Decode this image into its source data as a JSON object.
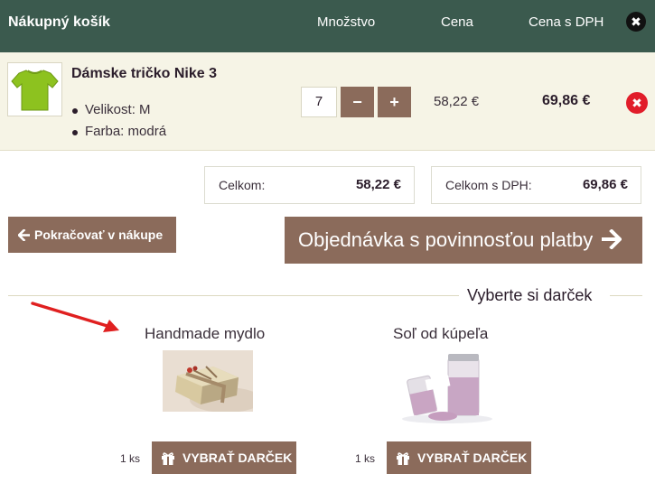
{
  "header": {
    "title": "Nákupný košík",
    "col_quantity": "Množstvo",
    "col_price": "Cena",
    "col_price_vat": "Cena s DPH",
    "close_icon": "✖"
  },
  "item": {
    "name": "Dámske tričko Nike 3",
    "attributes": [
      "Velikost: M",
      "Farba: modrá"
    ],
    "quantity": "7",
    "minus_label": "−",
    "plus_label": "+",
    "price": "58,22 €",
    "price_vat": "69,86 €",
    "remove_icon": "✖",
    "image_icon": "green-tshirt-image"
  },
  "totals": {
    "total_label": "Celkom:",
    "total_value": "58,22 €",
    "total_vat_label": "Celkom s DPH:",
    "total_vat_value": "69,86 €"
  },
  "actions": {
    "continue_label": "Pokračovať v nákupe",
    "continue_icon": "arrow-left-icon",
    "order_label": "Objednávka s povinnosťou platby",
    "order_icon": "arrow-right-icon"
  },
  "gifts": {
    "section_title": "Vyberte si darček",
    "items": [
      {
        "name": "Handmade mydlo",
        "qty": "1 ks",
        "button_label": "VYBRAŤ DARČEK",
        "icon": "gift-icon"
      },
      {
        "name": "Soľ od kúpeľa",
        "qty": "1 ks",
        "button_label": "VYBRAŤ DARČEK",
        "icon": "gift-icon"
      }
    ]
  },
  "colors": {
    "header_bg": "#3b5a4e",
    "button_brown": "#8b6b5b",
    "row_bg": "#f6f4e6",
    "remove_red": "#e11d2a",
    "arrow_red": "#e02020"
  }
}
